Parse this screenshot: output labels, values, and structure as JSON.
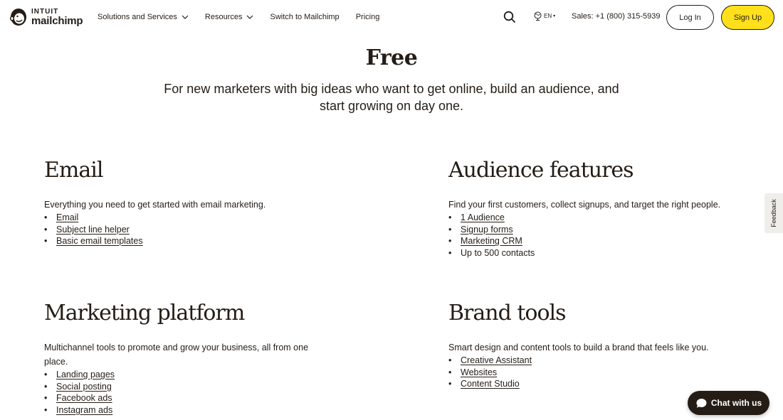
{
  "header": {
    "logo": {
      "top": "INTUIT",
      "bottom": "mailchimp"
    },
    "nav": [
      {
        "label": "Solutions and Services",
        "has_dropdown": true
      },
      {
        "label": "Resources",
        "has_dropdown": true
      },
      {
        "label": "Switch to Mailchimp",
        "has_dropdown": false
      },
      {
        "label": "Pricing",
        "has_dropdown": false
      }
    ],
    "search_icon": "search-icon",
    "language": {
      "code": "EN",
      "icon": "globe-icon"
    },
    "sales_phone": "Sales: +1 (800) 315-5939",
    "login_label": "Log In",
    "signup_label": "Sign Up"
  },
  "hero": {
    "title": "Free",
    "subtitle": "For new marketers with big ideas who want to get online, build an audience, and start growing on day one."
  },
  "features": {
    "email": {
      "title": "Email",
      "description": "Everything you need to get started with email marketing.",
      "items": [
        {
          "label": "Email",
          "link": true
        },
        {
          "label": "Subject line helper",
          "link": true
        },
        {
          "label": "Basic email templates",
          "link": true
        }
      ]
    },
    "audience": {
      "title": "Audience features",
      "description": "Find your first customers, collect signups, and target the right people.",
      "items": [
        {
          "label": "1 Audience",
          "link": true
        },
        {
          "label": "Signup forms",
          "link": true
        },
        {
          "label": "Marketing CRM",
          "link": true
        },
        {
          "label": "Up to 500 contacts",
          "link": false
        }
      ]
    },
    "marketing": {
      "title": "Marketing platform",
      "description": "Multichannel tools to promote and grow your business, all from one place.",
      "items": [
        {
          "label": "Landing pages",
          "link": true
        },
        {
          "label": "Social posting",
          "link": true
        },
        {
          "label": "Facebook ads",
          "link": true
        },
        {
          "label": "Instagram ads",
          "link": true
        }
      ]
    },
    "brand": {
      "title": "Brand tools",
      "description": "Smart design and content tools to build a brand that feels like you.",
      "items": [
        {
          "label": "Creative Assistant",
          "link": true
        },
        {
          "label": "Websites",
          "link": true
        },
        {
          "label": "Content Studio",
          "link": true
        }
      ]
    }
  },
  "feedback_label": "Feedback",
  "chat_label": "Chat with us",
  "colors": {
    "text": "#241c15",
    "signup_bg": "#ffe01b",
    "chat_bg": "#241c15",
    "feedback_bg": "#efeeea"
  }
}
